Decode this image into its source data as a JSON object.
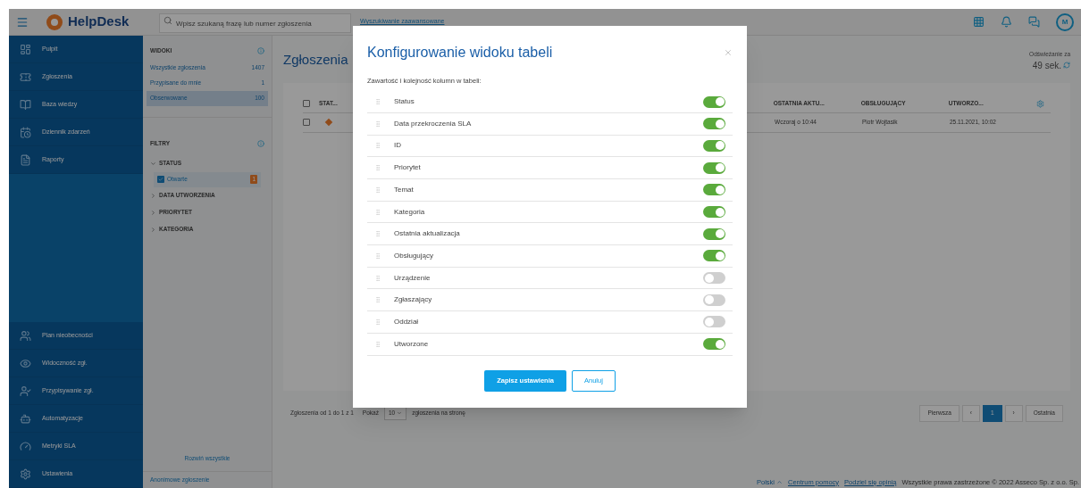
{
  "topbar": {
    "logo": "HelpDesk",
    "search": {
      "placeholder": "Wpisz szukaną frazę lub numer zgłoszenia"
    },
    "advanced_link": "Wyszukiwanie zaawansowane",
    "avatar": "M"
  },
  "sidebar": {
    "items": [
      {
        "label": "Pulpit"
      },
      {
        "label": "Zgłoszenia"
      },
      {
        "label": "Baza wiedzy"
      },
      {
        "label": "Dziennik zdarzeń"
      },
      {
        "label": "Raporty"
      }
    ],
    "admin_items": [
      {
        "label": "Plan nieobecności"
      },
      {
        "label": "Widoczność zgł."
      },
      {
        "label": "Przypisywanie zgł."
      },
      {
        "label": "Automatyzacje"
      },
      {
        "label": "Metryki SLA"
      },
      {
        "label": "Ustawienia"
      }
    ]
  },
  "views": {
    "title": "WIDOKI",
    "items": [
      {
        "label": "Wszystkie zgłoszenia",
        "count": "1407",
        "selected": false
      },
      {
        "label": "Przypisane do mnie",
        "count": "1",
        "selected": false
      },
      {
        "label": "Obserwowane",
        "count": "100",
        "selected": true
      }
    ]
  },
  "filters": {
    "title": "FILTRY",
    "groups": [
      {
        "label": "STATUS",
        "expanded": true,
        "options": [
          {
            "label": "Otwarte",
            "checked": true,
            "count": "1"
          }
        ]
      },
      {
        "label": "DATA UTWORZENIA",
        "expanded": false
      },
      {
        "label": "PRIORYTET",
        "expanded": false
      },
      {
        "label": "KATEGORIA",
        "expanded": false
      }
    ],
    "expand_all": "Rozwiń wszystkie",
    "anonymous": "Anonimowe zgłoszenie"
  },
  "main": {
    "title": "Zgłoszenia",
    "refresh_label": "Odświeżanie za",
    "refresh_time": "49 sek.",
    "table": {
      "select_all_checked": false,
      "status_column": "STAT...",
      "columns": [
        "OSTATNIA AKTU...",
        "OBSŁUGUJĄCY",
        "UTWORZO..."
      ],
      "rows": [
        {
          "checked": false,
          "cells": [
            "Wczoraj o 10:44",
            "Piotr Wojtasik",
            "25.11.2021, 10:02"
          ]
        }
      ]
    },
    "pager": {
      "summary": "Zgłoszenia od 1 do 1 z 1",
      "show": "Pokaż",
      "page_size": "10",
      "per_page": "zgłoszenia na stronę",
      "buttons": [
        {
          "label": "Pierwsza",
          "selected": false
        },
        {
          "label": "‹",
          "selected": false
        },
        {
          "label": "1",
          "selected": true
        },
        {
          "label": "›",
          "selected": false
        },
        {
          "label": "Ostatnia",
          "selected": false
        }
      ]
    }
  },
  "footer": {
    "language": "Polski",
    "links": [
      "Centrum pomocy",
      "Podziel się opinią"
    ],
    "copyright": "Wszystkie prawa zastrzeżone © 2022 Asseco Sp. z o.o. Sp."
  },
  "modal": {
    "title": "Konfigurowanie widoku tabeli",
    "subtitle": "Zawartość i kolejność kolumn w tabeli:",
    "columns": [
      {
        "label": "Status",
        "on": true
      },
      {
        "label": "Data przekroczenia SLA",
        "on": true
      },
      {
        "label": "ID",
        "on": true
      },
      {
        "label": "Priorytet",
        "on": true
      },
      {
        "label": "Temat",
        "on": true
      },
      {
        "label": "Kategoria",
        "on": true
      },
      {
        "label": "Ostatnia aktualizacja",
        "on": true
      },
      {
        "label": "Obsługujący",
        "on": true
      },
      {
        "label": "Urządzenie",
        "on": false
      },
      {
        "label": "Zgłaszający",
        "on": false
      },
      {
        "label": "Oddział",
        "on": false
      },
      {
        "label": "Utworzone",
        "on": true
      }
    ],
    "save": "Zapisz ustawienia",
    "cancel": "Anuluj"
  }
}
